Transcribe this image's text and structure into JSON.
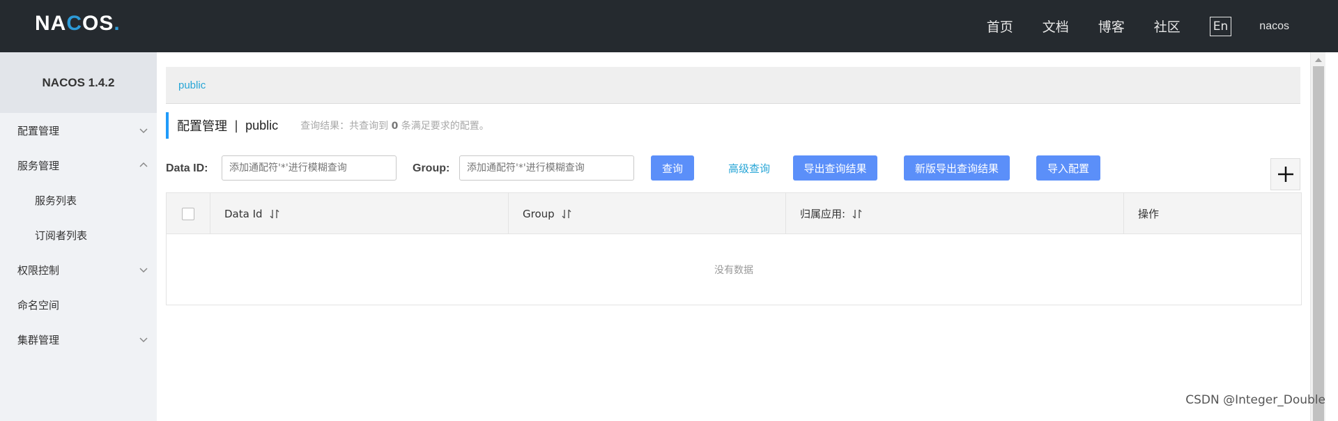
{
  "header": {
    "logo_text": "NACOS.",
    "nav": [
      "首页",
      "文档",
      "博客",
      "社区"
    ],
    "lang_button": "En",
    "user": "nacos"
  },
  "sidebar": {
    "title": "NACOS 1.4.2",
    "items": [
      {
        "label": "配置管理",
        "expanded": false
      },
      {
        "label": "服务管理",
        "expanded": true
      },
      {
        "label": "服务列表"
      },
      {
        "label": "订阅者列表"
      },
      {
        "label": "权限控制",
        "expanded": false
      },
      {
        "label": "命名空间"
      },
      {
        "label": "集群管理",
        "expanded": false
      }
    ]
  },
  "namespace_bar": {
    "active": "public"
  },
  "title": {
    "main": "配置管理",
    "separator": "|",
    "namespace": "public",
    "result_prefix": "查询结果：共查询到",
    "result_count": "0",
    "result_suffix": "条满足要求的配置。"
  },
  "search": {
    "data_id_label": "Data ID:",
    "data_id_placeholder": "添加通配符'*'进行模糊查询",
    "group_label": "Group:",
    "group_placeholder": "添加通配符'*'进行模糊查询",
    "query_button": "查询",
    "advanced_link": "高级查询",
    "export_button": "导出查询结果",
    "new_export_button": "新版导出查询结果",
    "import_button": "导入配置"
  },
  "table": {
    "columns": [
      "Data Id",
      "Group",
      "归属应用:",
      "操作"
    ],
    "empty_text": "没有数据"
  },
  "watermark": "CSDN @Integer_Double",
  "colors": {
    "header_bg": "#252a2f",
    "primary_button": "#5b8ff9",
    "link": "#26a5d6",
    "title_accent": "#209bfa"
  }
}
